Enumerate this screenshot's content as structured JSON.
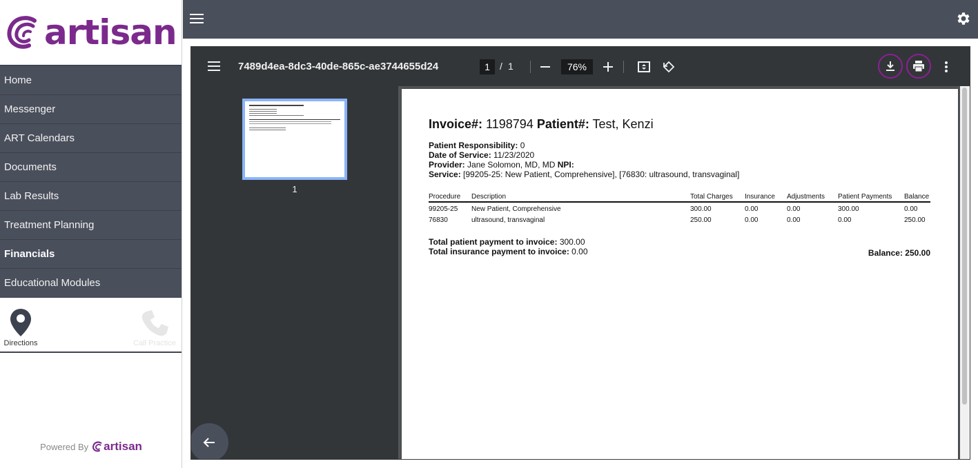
{
  "brand": {
    "name": "artisan",
    "color": "#7b2a8c",
    "accent": "#8e1f95"
  },
  "sidebar": {
    "items": [
      {
        "label": "Home"
      },
      {
        "label": "Messenger"
      },
      {
        "label": "ART Calendars"
      },
      {
        "label": "Documents"
      },
      {
        "label": "Lab Results"
      },
      {
        "label": "Treatment Planning"
      },
      {
        "label": "Financials",
        "active": true
      },
      {
        "label": "Educational Modules"
      }
    ],
    "quick_actions": {
      "directions": "Directions",
      "call": "Call Practice"
    },
    "powered_by": "Powered By",
    "powered_brand": "artisan"
  },
  "topbar": {
    "menu_icon": "hamburger-icon",
    "settings_icon": "gear-icon"
  },
  "viewer": {
    "title": "7489d4ea-8dc3-40de-865c-ae3744655d24",
    "page_current": "1",
    "page_sep": "/",
    "page_total": "1",
    "zoom": "76%",
    "thumb_label": "1"
  },
  "invoice": {
    "inv_label": "Invoice#:",
    "inv_number": "1198794",
    "patient_label": "Patient#:",
    "patient_name": "Test, Kenzi",
    "responsibility_label": "Patient Responsibility:",
    "responsibility_value": "0",
    "dos_label": "Date of Service:",
    "dos_value": "11/23/2020",
    "provider_label": "Provider:",
    "provider_value": "Jane Solomon, MD, MD",
    "npi_label": "NPI:",
    "service_label": "Service:",
    "service_value": "[99205-25: New Patient, Comprehensive], [76830: ultrasound, transvaginal]",
    "columns": [
      "Procedure",
      "Description",
      "Total Charges",
      "Insurance",
      "Adjustments",
      "Patient Payments",
      "Balance"
    ],
    "rows": [
      [
        "99205-25",
        "New Patient, Comprehensive",
        "300.00",
        "0.00",
        "0.00",
        "300.00",
        "0.00"
      ],
      [
        "76830",
        "ultrasound, transvaginal",
        "250.00",
        "0.00",
        "0.00",
        "0.00",
        "250.00"
      ]
    ],
    "total_patient_label": "Total patient payment to invoice:",
    "total_patient_value": "300.00",
    "total_ins_label": "Total insurance payment to invoice:",
    "total_ins_value": "0.00",
    "balance_label": "Balance:",
    "balance_value": "250.00"
  }
}
